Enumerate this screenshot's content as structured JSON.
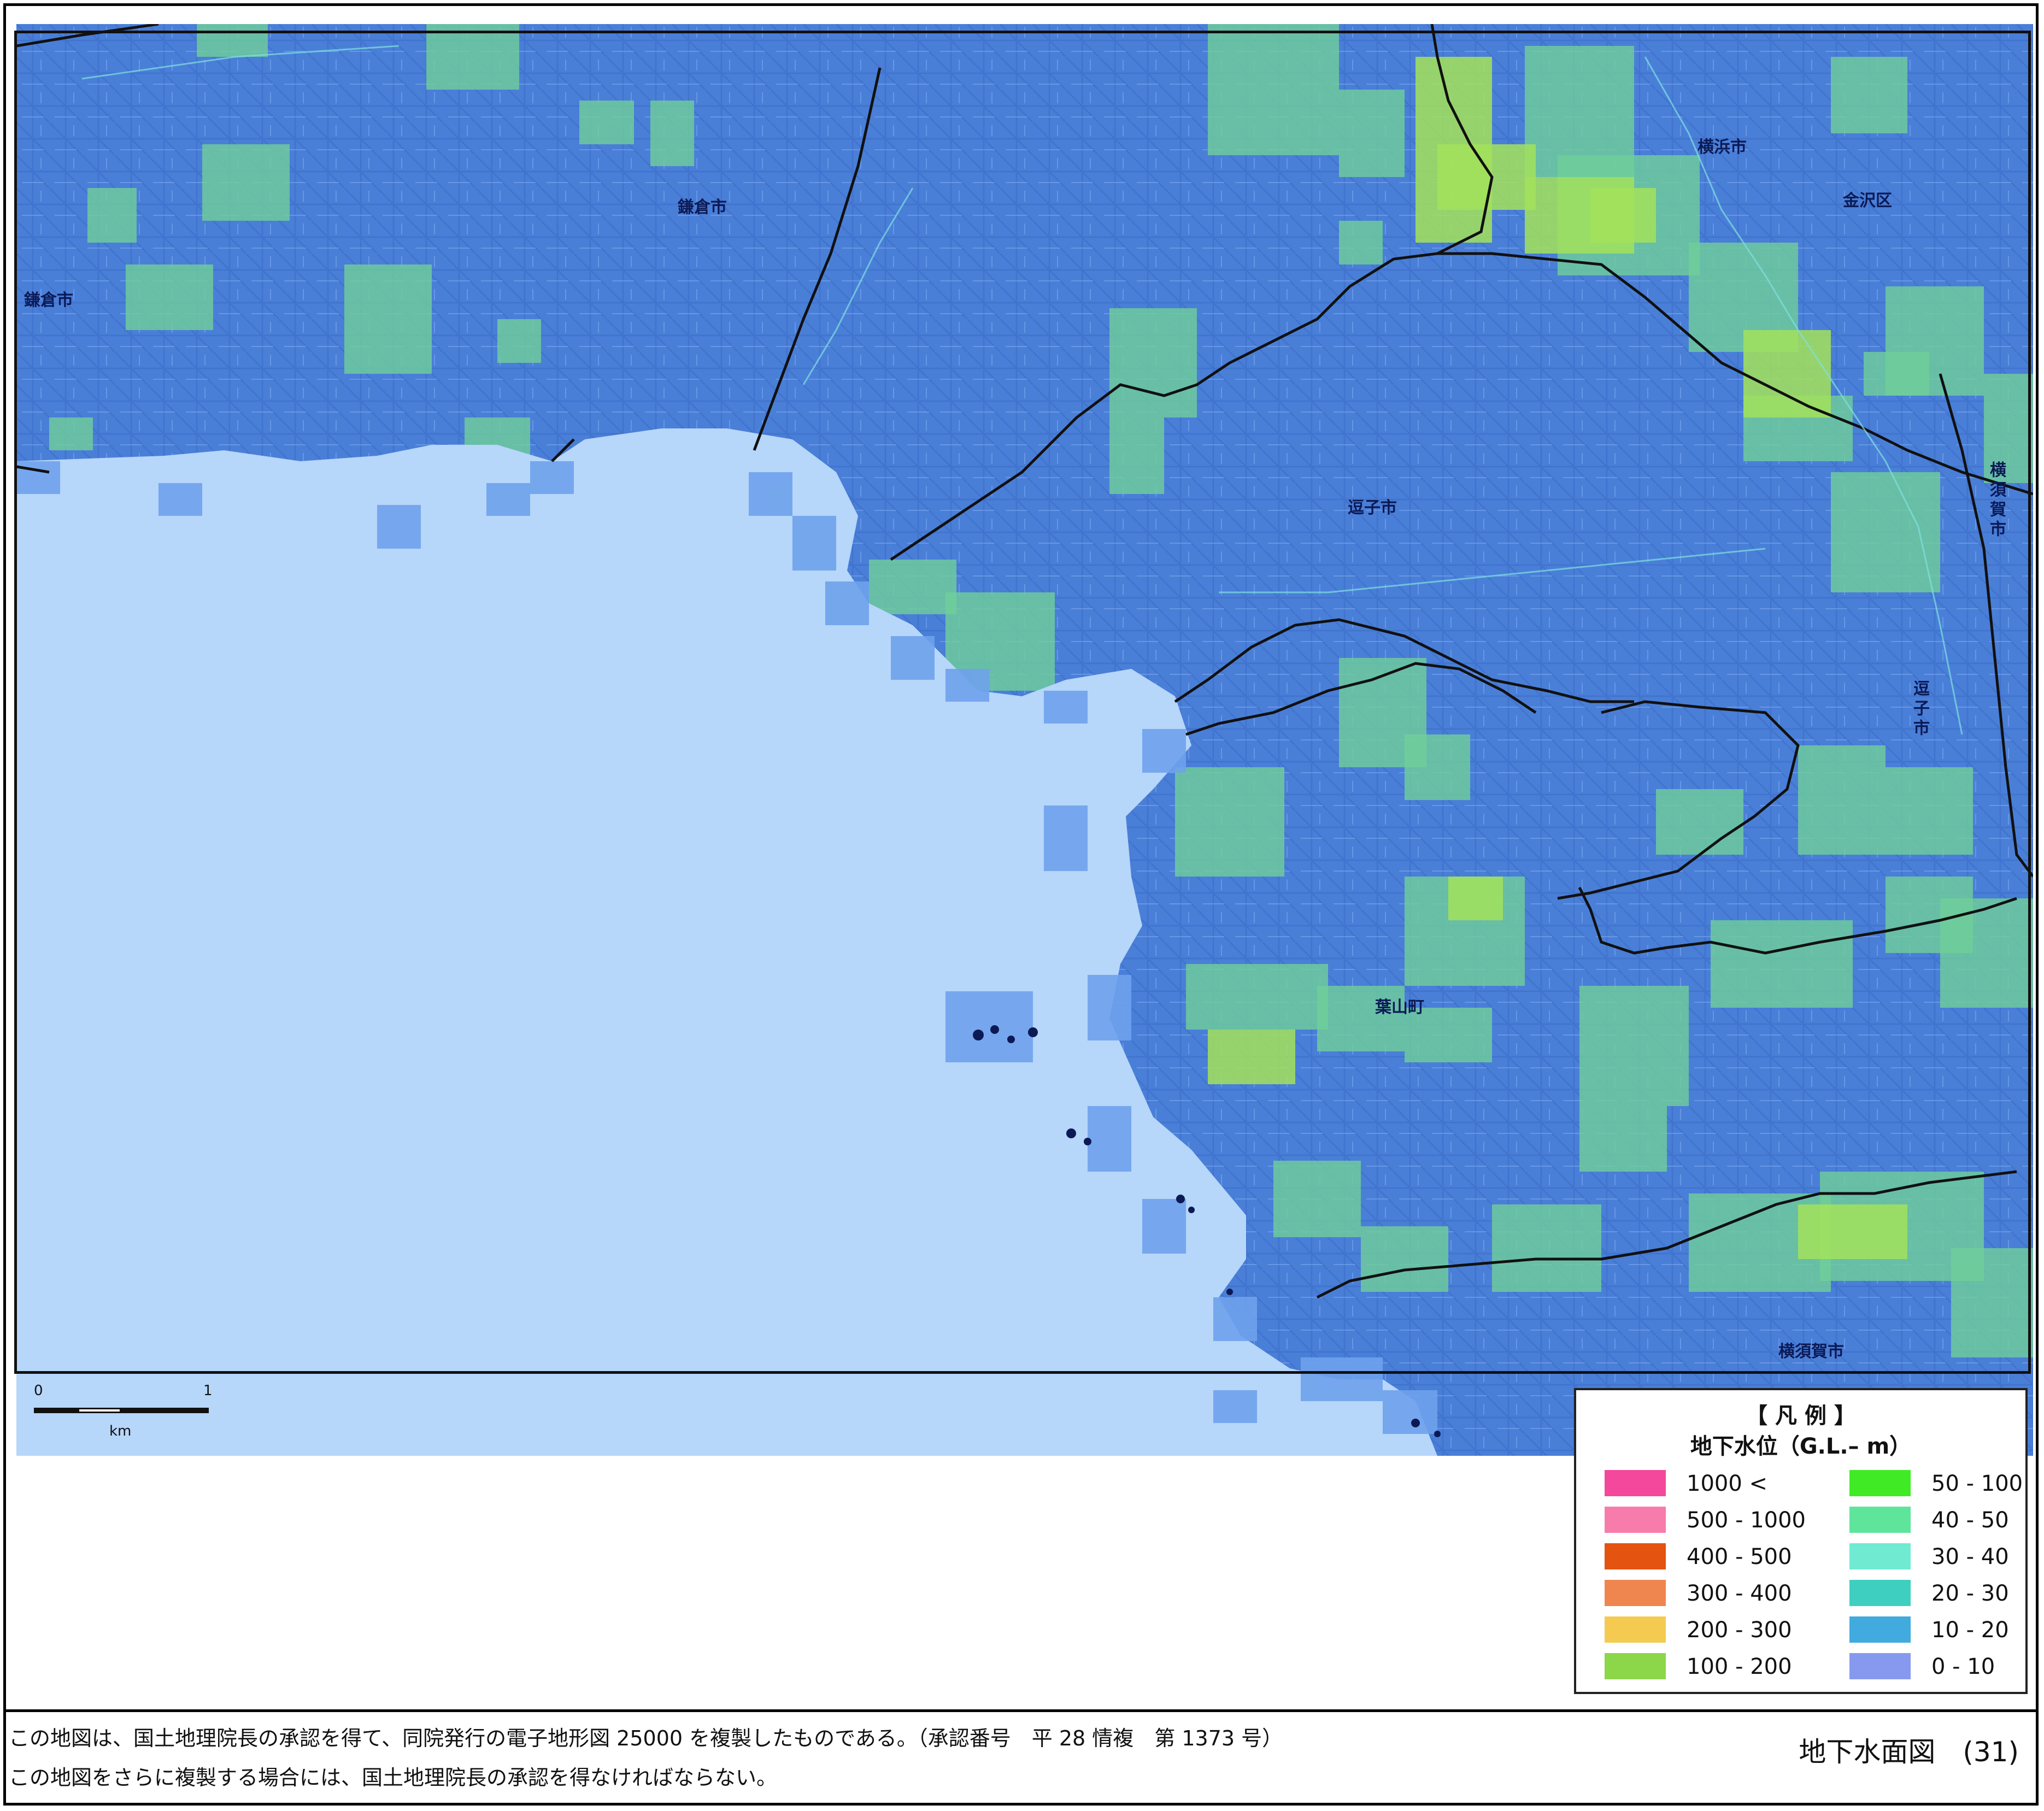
{
  "places": [
    {
      "id": "kamakura-city",
      "text": "鎌倉市"
    },
    {
      "id": "kamakura-city-west",
      "text": "鎌倉市"
    },
    {
      "id": "yokohama-city",
      "text": "横浜市"
    },
    {
      "id": "kanazawa-ward",
      "text": "金沢区"
    },
    {
      "id": "zushi-city",
      "text": "逗子市"
    },
    {
      "id": "zushi-city-east",
      "text": "逗子市"
    },
    {
      "id": "yokosuka-city-north",
      "text": "横須賀市"
    },
    {
      "id": "yokosuka-city-south",
      "text": "横須賀市"
    },
    {
      "id": "hayama-town",
      "text": "葉山町"
    }
  ],
  "scale_bar": {
    "start": "0",
    "end": "1",
    "unit": "km"
  },
  "legend": {
    "title": "【 凡 例 】",
    "subtitle": "地下水位（G.L.– m）",
    "items": [
      {
        "label": "1000 <",
        "color": "#f4489c"
      },
      {
        "label": "500 - 1000",
        "color": "#f77bab"
      },
      {
        "label": "400 - 500",
        "color": "#e4530f"
      },
      {
        "label": "300 - 400",
        "color": "#ef8650"
      },
      {
        "label": "200 - 300",
        "color": "#f4cb50"
      },
      {
        "label": "100 - 200",
        "color": "#8cd64a"
      },
      {
        "label": "50 - 100",
        "color": "#40ea25"
      },
      {
        "label": "40 - 50",
        "color": "#5ee59b"
      },
      {
        "label": "30 - 40",
        "color": "#70ebd2"
      },
      {
        "label": "20 - 30",
        "color": "#3fcfc0"
      },
      {
        "label": "10 - 20",
        "color": "#41aadf"
      },
      {
        "label": "0 - 10",
        "color": "#8799ee"
      }
    ]
  },
  "footer": {
    "line1": "この地図は、国土地理院長の承認を得て、同院発行の電子地形図 25000 を複製したものである。（承認番号　平 28 情複　第 1373 号）",
    "line2": "この地図をさらに複製する場合には、国土地理院長の承認を得なければならない。",
    "caption": "地下水面図　(31)"
  },
  "map_colors": {
    "land": "#4a7fd8",
    "sea": "#b6d6fa",
    "coastal_cell": "#6fa2ec",
    "level_40_50_cell": "#6fcf9a",
    "level_50_100_cell": "#a3e25a",
    "boundary_line": "#111111"
  }
}
